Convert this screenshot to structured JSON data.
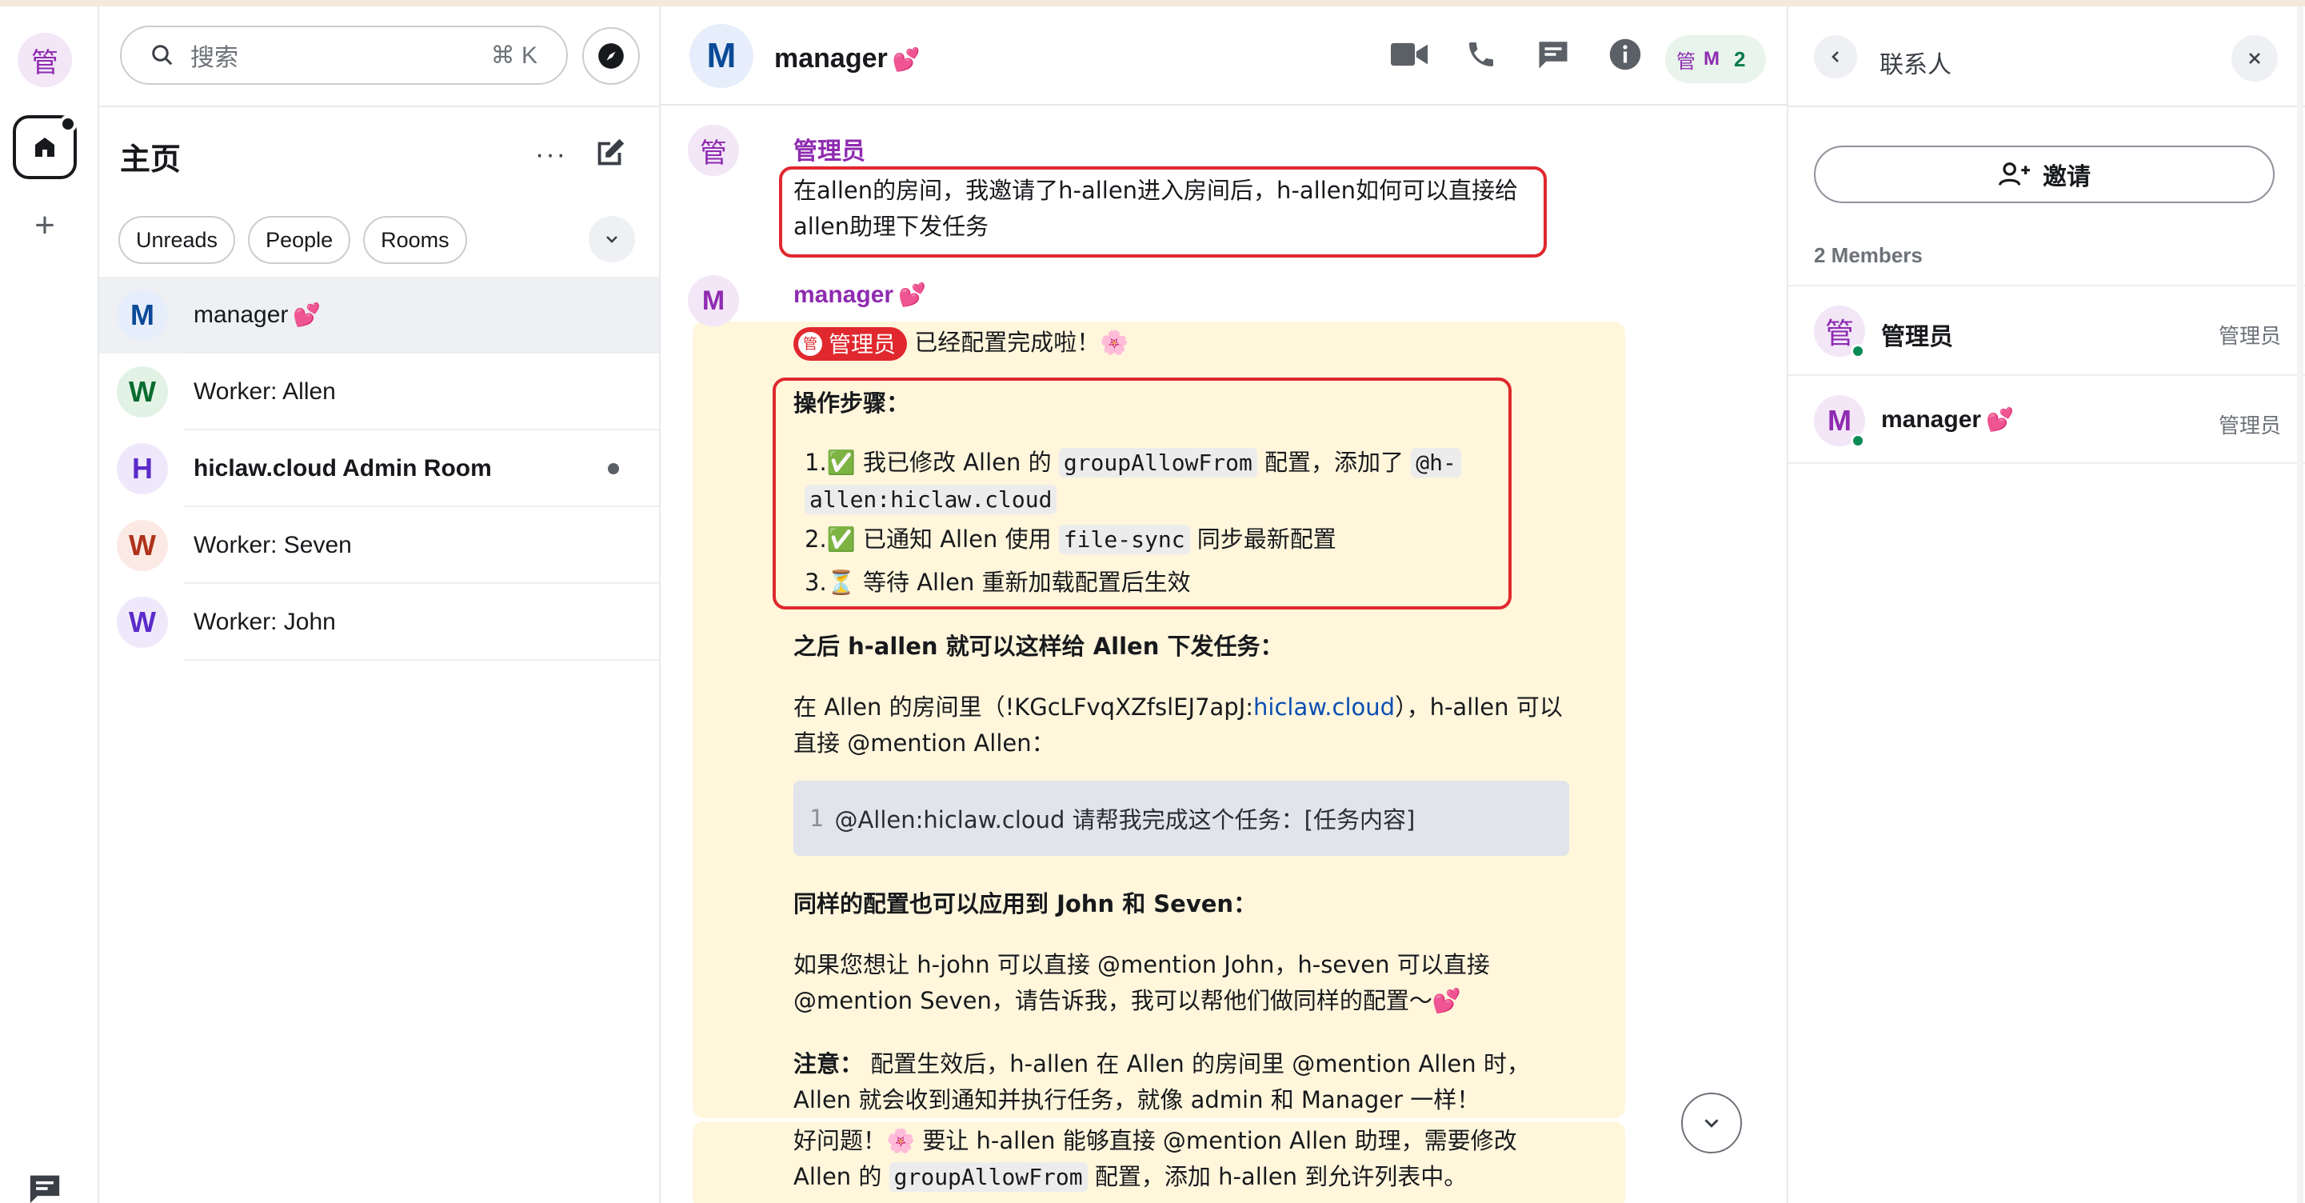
{
  "rail": {
    "space_avatar": "管",
    "add": "+"
  },
  "roomlist": {
    "search_placeholder": "搜索",
    "search_shortcut": "⌘ K",
    "home_title": "主页",
    "more": "···",
    "filters": [
      "Unreads",
      "People",
      "Rooms"
    ],
    "rooms": [
      {
        "avatar": "M",
        "name": "manager",
        "heart": "💕",
        "active": true,
        "bold": false,
        "unread": false,
        "color": "#0b4a97",
        "bg": "#e6eefb"
      },
      {
        "avatar": "W",
        "name": "Worker: Allen",
        "heart": "",
        "active": false,
        "bold": false,
        "unread": false,
        "color": "#0a6b2e",
        "bg": "#e2f3e6"
      },
      {
        "avatar": "H",
        "name": "hiclaw.cloud Admin Room",
        "heart": "",
        "active": false,
        "bold": true,
        "unread": true,
        "color": "#5b2bc9",
        "bg": "#efe8fb"
      },
      {
        "avatar": "W",
        "name": "Worker: Seven",
        "heart": "",
        "active": false,
        "bold": false,
        "unread": false,
        "color": "#b0321a",
        "bg": "#fbeae4"
      },
      {
        "avatar": "W",
        "name": "Worker: John",
        "heart": "",
        "active": false,
        "bold": false,
        "unread": false,
        "color": "#5b2bc9",
        "bg": "#efe8fb"
      }
    ]
  },
  "chat": {
    "avatar": "M",
    "title": "manager",
    "title_heart": "💕",
    "facepile": {
      "a1": "管",
      "a2": "M",
      "count": "2"
    },
    "msg1": {
      "avatar": "管",
      "sender": "管理员",
      "line1": "在allen的房间，我邀请了h-allen进入房间后，h-allen如何可以直接给",
      "line2": "allen助理下发任务"
    },
    "msg2": {
      "avatar": "M",
      "sender": "manager",
      "sender_heart": "💕",
      "pill_avatar": "管",
      "pill_label": "管理员",
      "intro": " 已经配置完成啦！🌸",
      "steps_title": "操作步骤：",
      "step1_num": "1.",
      "step1_a": "✅ 我已修改 Allen 的 ",
      "step1_code": "groupAllowFrom",
      "step1_b": " 配置，添加了 ",
      "step1_code2a": "@h-",
      "step1_code2b": "allen:hiclaw.cloud",
      "step2_num": "2.",
      "step2_a": "✅ 已通知 Allen 使用 ",
      "step2_code": "file-sync",
      "step2_b": " 同步最新配置",
      "step3_num": "3.",
      "step3": "⏳ 等待 Allen 重新加载配置后生效",
      "after_title": "之后 h-allen 就可以这样给 Allen 下发任务：",
      "room_line1_a": "在 Allen 的房间里（!KGcLFvqXZfslEJ7apJ:",
      "room_link": "hiclaw.cloud",
      "room_line1_b": "），h-allen 可以",
      "room_line2": "直接 @mention Allen：",
      "code_ln": "1",
      "code_text": "@Allen:hiclaw.cloud 请帮我完成这个任务：[任务内容]",
      "same_title": "同样的配置也可以应用到 John 和 Seven：",
      "same_line1": "如果您想让 h-john 可以直接 @mention John，h-seven 可以直接",
      "same_line2": "@mention Seven，请告诉我，我可以帮他们做同样的配置～💕",
      "note_label": "注意：",
      "note_line1": " 配置生效后，h-allen 在 Allen 的房间里 @mention Allen 时，",
      "note_line2": "Allen 就会收到通知并执行任务，就像 admin 和 Manager 一样！",
      "good_line1": "好问题！🌸 要让 h-allen 能够直接 @mention Allen 助理，需要修改",
      "good_line2a": "Allen 的 ",
      "good_code": "groupAllowFrom",
      "good_line2b": " 配置，添加 h-allen 到允许列表中。"
    }
  },
  "rpanel": {
    "title": "联系人",
    "invite": "邀请",
    "members_count": "2 Members",
    "members": [
      {
        "avatar": "管",
        "name": "管理员",
        "heart": "",
        "role": "管理员",
        "color": "#8e2bb0",
        "bg": "#f2e6f7"
      },
      {
        "avatar": "M",
        "name": "manager",
        "heart": "💕",
        "role": "管理员",
        "color": "#8e2bb0",
        "bg": "#f2e6f7"
      }
    ]
  }
}
